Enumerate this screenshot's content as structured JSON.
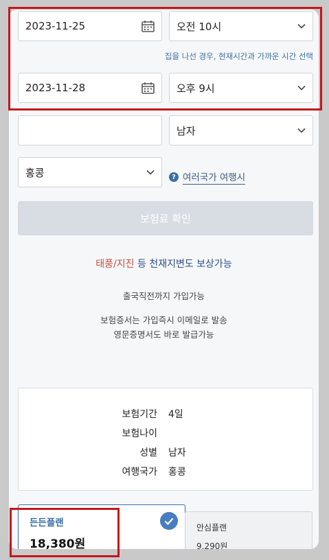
{
  "trip": {
    "start_date": "2023-11-25",
    "start_time": "오전 10시",
    "hint": "집을 나선 경우, 현재시간과 가까운 시간 선택",
    "end_date": "2023-11-28",
    "end_time": "오후 9시",
    "birth_value": "",
    "gender": "남자",
    "country": "홍콩",
    "multi_country": "여러국가 여행시"
  },
  "confirm_button": "보험료 확인",
  "promo": {
    "part_red": "태풍/지진",
    "part_blue": " 등 천재지변도 보상가능"
  },
  "info": {
    "line1": "출국직전까지 가입가능",
    "line2": "보험증서는 가입즉시 이메일로 발송",
    "line3": "영문증명서도 바로 발급가능"
  },
  "summary": {
    "rows": [
      {
        "label": "보험기간",
        "value": "4일"
      },
      {
        "label": "보험나이",
        "value": ""
      },
      {
        "label": "성별",
        "value": "남자"
      },
      {
        "label": "여행국가",
        "value": "홍콩"
      }
    ]
  },
  "plans": [
    {
      "name": "든든플랜",
      "price": "18,380원",
      "selected": true
    },
    {
      "name": "안심플랜",
      "price": "9,290원",
      "selected": false
    }
  ],
  "colors": {
    "accent": "#3a6ea5",
    "highlight_box": "#c4161c",
    "promo_red": "#c94a3c",
    "button_disabled": "#d8dde4"
  },
  "icons": {
    "date": "calendar-icon",
    "select": "chevron-down-icon",
    "help": "question-icon",
    "selected": "check-icon"
  }
}
